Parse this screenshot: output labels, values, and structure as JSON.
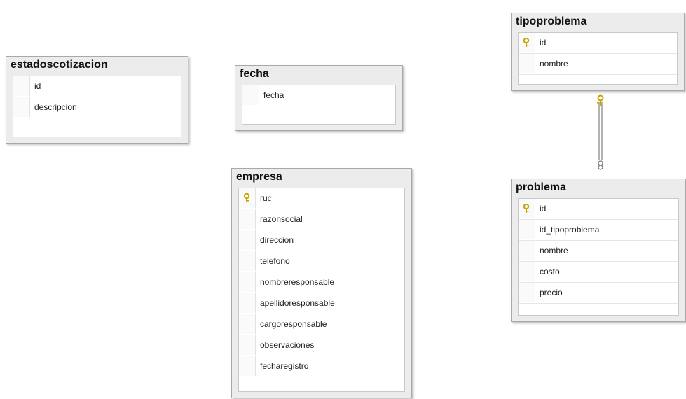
{
  "tables": [
    {
      "id": "estadoscotizacion",
      "title": "estadoscotizacion",
      "columns": [
        {
          "name": "id",
          "pk": false
        },
        {
          "name": "descripcion",
          "pk": false
        }
      ]
    },
    {
      "id": "fecha",
      "title": "fecha",
      "columns": [
        {
          "name": "fecha",
          "pk": false
        }
      ]
    },
    {
      "id": "empresa",
      "title": "empresa",
      "columns": [
        {
          "name": "ruc",
          "pk": true
        },
        {
          "name": "razonsocial",
          "pk": false
        },
        {
          "name": "direccion",
          "pk": false
        },
        {
          "name": "telefono",
          "pk": false
        },
        {
          "name": "nombreresponsable",
          "pk": false
        },
        {
          "name": "apellidoresponsable",
          "pk": false
        },
        {
          "name": "cargoresponsable",
          "pk": false
        },
        {
          "name": "observaciones",
          "pk": false
        },
        {
          "name": "fecharegistro",
          "pk": false
        }
      ]
    },
    {
      "id": "tipoproblema",
      "title": "tipoproblema",
      "columns": [
        {
          "name": "id",
          "pk": true
        },
        {
          "name": "nombre",
          "pk": false
        }
      ]
    },
    {
      "id": "problema",
      "title": "problema",
      "columns": [
        {
          "name": "id",
          "pk": true
        },
        {
          "name": "id_tipoproblema",
          "pk": false
        },
        {
          "name": "nombre",
          "pk": false
        },
        {
          "name": "costo",
          "pk": false
        },
        {
          "name": "precio",
          "pk": false
        }
      ]
    }
  ],
  "relationships": [
    {
      "from": "tipoproblema",
      "to": "problema",
      "from_end": "key-icon",
      "to_end": "infinity-icon"
    }
  ],
  "colors": {
    "key": "#d8b400",
    "connector": "#9a9a9a"
  }
}
